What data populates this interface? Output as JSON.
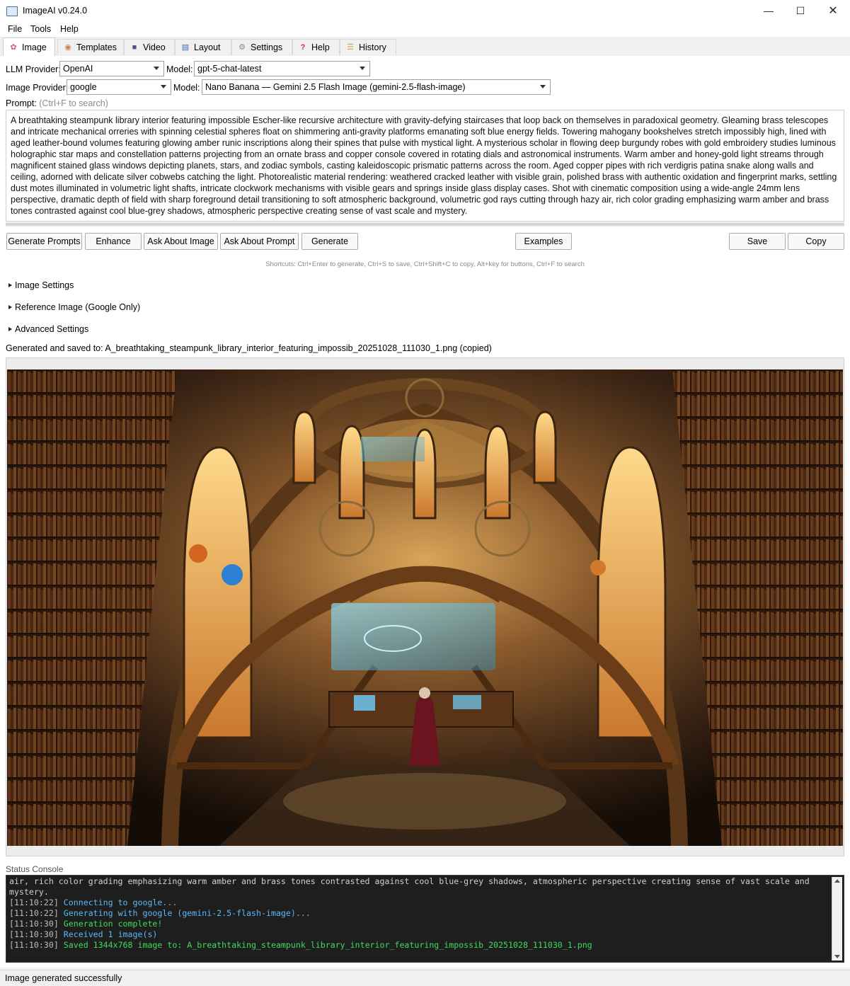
{
  "window": {
    "title": "ImageAI v0.24.0"
  },
  "menu": [
    "File",
    "Tools",
    "Help"
  ],
  "tabs": [
    {
      "label": "Image",
      "icon": "brain-icon"
    },
    {
      "label": "Templates",
      "icon": "palette-icon"
    },
    {
      "label": "Video",
      "icon": "clapper-icon"
    },
    {
      "label": "Layout",
      "icon": "book-icon"
    },
    {
      "label": "Settings",
      "icon": "gear-icon"
    },
    {
      "label": "Help",
      "icon": "question-icon"
    },
    {
      "label": "History",
      "icon": "scroll-icon"
    }
  ],
  "llm": {
    "provider_label": "LLM Provider:",
    "provider": "OpenAI",
    "model_label": "Model:",
    "model": "gpt-5-chat-latest"
  },
  "image_provider": {
    "provider_label": "Image Provider:",
    "provider": "google",
    "model_label": "Model:",
    "model": "Nano Banana — Gemini 2.5 Flash Image (gemini-2.5-flash-image)"
  },
  "prompt": {
    "label": "Prompt:",
    "hint": "(Ctrl+F to search)",
    "text": "A breathtaking steampunk library interior featuring impossible Escher-like recursive architecture with gravity-defying staircases that loop back on themselves in paradoxical geometry. Gleaming brass telescopes and intricate mechanical orreries with spinning celestial spheres float on shimmering anti-gravity platforms emanating soft blue energy fields. Towering mahogany bookshelves stretch impossibly high, lined with aged leather-bound volumes featuring glowing amber runic inscriptions along their spines that pulse with mystical light. A mysterious scholar in flowing deep burgundy robes with gold embroidery studies luminous holographic star maps and constellation patterns projecting from an ornate brass and copper console covered in rotating dials and astronomical instruments. Warm amber and honey-gold light streams through magnificent stained glass windows depicting planets, stars, and zodiac symbols, casting kaleidoscopic prismatic patterns across the room. Aged copper pipes with rich verdigris patina snake along walls and ceiling, adorned with delicate silver cobwebs catching the light. Photorealistic material rendering: weathered cracked leather with visible grain, polished brass with authentic oxidation and fingerprint marks, settling dust motes illuminated in volumetric light shafts, intricate clockwork mechanisms with visible gears and springs inside glass display cases. Shot with cinematic composition using a wide-angle 24mm lens perspective, dramatic depth of field with sharp foreground detail transitioning to soft atmospheric background, volumetric god rays cutting through hazy air, rich color grading emphasizing warm amber and brass tones contrasted against cool blue-grey shadows, atmospheric perspective creating sense of vast scale and mystery."
  },
  "buttons": {
    "generate_prompts": "Generate Prompts",
    "enhance": "Enhance",
    "ask_image": "Ask About Image",
    "ask_prompt": "Ask About Prompt",
    "generate": "Generate",
    "examples": "Examples",
    "save": "Save",
    "copy": "Copy"
  },
  "shortcuts": "Shortcuts: Ctrl+Enter to generate, Ctrl+S to save, Ctrl+Shift+C to copy, Alt+key for buttons, Ctrl+F to search",
  "sections": [
    "Image Settings",
    "Reference Image (Google Only)",
    "Advanced Settings"
  ],
  "saved_message": "Generated and saved to: A_breathtaking_steampunk_library_interior_featuring_impossib_20251028_111030_1.png (copied)",
  "console": {
    "label": "Status Console",
    "wrap_lines": [
      "air, rich color grading emphasizing warm amber and brass tones contrasted against cool blue-grey shadows, atmospheric perspective creating sense of vast scale and",
      "mystery."
    ],
    "entries": [
      {
        "ts": "[11:10:22]",
        "msg": "Connecting to google...",
        "kind": "info"
      },
      {
        "ts": "[11:10:22]",
        "msg": "Generating with google (gemini-2.5-flash-image)...",
        "kind": "info"
      },
      {
        "ts": "[11:10:30]",
        "msg": "Generation complete!",
        "kind": "ok"
      },
      {
        "ts": "[11:10:30]",
        "msg": "Received 1 image(s)",
        "kind": "info"
      },
      {
        "ts": "[11:10:30]",
        "msg": "Saved 1344x768 image to: A_breathtaking_steampunk_library_interior_featuring_impossib_20251028_111030_1.png",
        "kind": "ok"
      }
    ]
  },
  "status": "Image generated successfully"
}
